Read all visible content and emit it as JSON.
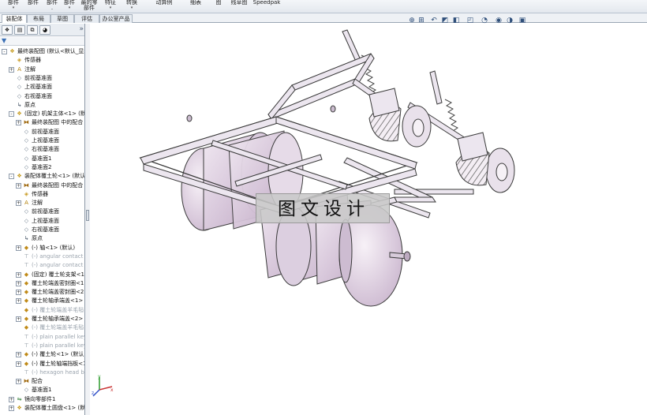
{
  "ribbon": {
    "items": [
      {
        "label": "部件",
        "arrow": true
      },
      {
        "label": "部件",
        "arrow": false
      },
      {
        "label": "部件\n.",
        "arrow": false
      },
      {
        "label": "部件",
        "arrow": true
      },
      {
        "label": "最的零\n部件",
        "arrow": false
      },
      {
        "label": "特征",
        "arrow": true
      },
      {
        "label": "转换",
        "arrow": true
      },
      {
        "label": "动算例",
        "arrow": false
      },
      {
        "label": "细表",
        "arrow": false
      },
      {
        "label": "图",
        "arrow": false
      },
      {
        "label": "线草图",
        "arrow": false
      },
      {
        "label": "Speedpak",
        "arrow": false
      }
    ]
  },
  "command_tabs": [
    {
      "label": "装配体",
      "active": true
    },
    {
      "label": "布局",
      "active": false
    },
    {
      "label": "草图",
      "active": false
    },
    {
      "label": "评估",
      "active": false
    },
    {
      "label": "办公室产品",
      "active": false
    }
  ],
  "panel": {
    "collapse_glyph": "»",
    "filter_glyph": "▼",
    "tree": [
      {
        "label": "最终装配图 (默认<默认_显示",
        "indent": 0,
        "toggle": "-",
        "icon": "assembly-icon",
        "dim": false
      },
      {
        "label": "传感器",
        "indent": 1,
        "toggle": "",
        "icon": "sensor-icon",
        "dim": false
      },
      {
        "label": "注解",
        "indent": 1,
        "toggle": "+",
        "icon": "annotation-icon",
        "dim": false
      },
      {
        "label": "前视基准面",
        "indent": 1,
        "toggle": "",
        "icon": "plane-icon",
        "dim": false
      },
      {
        "label": "上视基准面",
        "indent": 1,
        "toggle": "",
        "icon": "plane-icon",
        "dim": false
      },
      {
        "label": "右视基准面",
        "indent": 1,
        "toggle": "",
        "icon": "plane-icon",
        "dim": false
      },
      {
        "label": "原点",
        "indent": 1,
        "toggle": "",
        "icon": "origin-icon",
        "dim": false
      },
      {
        "label": "(固定) 机架主体<1> (默认",
        "indent": 1,
        "toggle": "-",
        "icon": "assembly-icon",
        "dim": false
      },
      {
        "label": "最终装配图 中的配合",
        "indent": 2,
        "toggle": "+",
        "icon": "mates-icon",
        "dim": false
      },
      {
        "label": "前视基准面",
        "indent": 2,
        "toggle": "",
        "icon": "plane-icon",
        "dim": false
      },
      {
        "label": "上视基准面",
        "indent": 2,
        "toggle": "",
        "icon": "plane-icon",
        "dim": false
      },
      {
        "label": "右视基准面",
        "indent": 2,
        "toggle": "",
        "icon": "plane-icon",
        "dim": false
      },
      {
        "label": "基准面1",
        "indent": 2,
        "toggle": "",
        "icon": "plane-icon",
        "dim": false
      },
      {
        "label": "基准面2",
        "indent": 2,
        "toggle": "",
        "icon": "plane-icon",
        "dim": false
      },
      {
        "label": "装配体覆土轮<1> (默认<",
        "indent": 1,
        "toggle": "-",
        "icon": "assembly-icon",
        "dim": false
      },
      {
        "label": "最终装配图 中的配合",
        "indent": 2,
        "toggle": "+",
        "icon": "mates-icon",
        "dim": false
      },
      {
        "label": "传感器",
        "indent": 2,
        "toggle": "",
        "icon": "sensor-icon",
        "dim": false
      },
      {
        "label": "注解",
        "indent": 2,
        "toggle": "+",
        "icon": "annotation-icon",
        "dim": false
      },
      {
        "label": "前视基准面",
        "indent": 2,
        "toggle": "",
        "icon": "plane-icon",
        "dim": false
      },
      {
        "label": "上视基准面",
        "indent": 2,
        "toggle": "",
        "icon": "plane-icon",
        "dim": false
      },
      {
        "label": "右视基准面",
        "indent": 2,
        "toggle": "",
        "icon": "plane-icon",
        "dim": false
      },
      {
        "label": "原点",
        "indent": 2,
        "toggle": "",
        "icon": "origin-icon",
        "dim": false
      },
      {
        "label": "(-) 轴<1> (默认)",
        "indent": 2,
        "toggle": "+",
        "icon": "part-icon",
        "dim": false
      },
      {
        "label": "(-) angular contact b",
        "indent": 2,
        "toggle": "",
        "icon": "toolbox-icon",
        "dim": true
      },
      {
        "label": "(-) angular contact b",
        "indent": 2,
        "toggle": "",
        "icon": "toolbox-icon",
        "dim": true
      },
      {
        "label": "(固定) 覆土轮支架<1>",
        "indent": 2,
        "toggle": "+",
        "icon": "part-icon",
        "dim": false
      },
      {
        "label": "覆土轮端盖密封圈<1>",
        "indent": 2,
        "toggle": "+",
        "icon": "part-icon",
        "dim": false
      },
      {
        "label": "覆土轮端盖密封圈<2>",
        "indent": 2,
        "toggle": "+",
        "icon": "part-icon",
        "dim": false
      },
      {
        "label": "覆土轮轴承端盖<1> (",
        "indent": 2,
        "toggle": "+",
        "icon": "part-icon",
        "dim": false
      },
      {
        "label": "(-) 覆土轮端盖羊毛毡",
        "indent": 2,
        "toggle": "",
        "icon": "part-icon",
        "dim": true
      },
      {
        "label": "覆土轮轴承端盖<2> (",
        "indent": 2,
        "toggle": "+",
        "icon": "part-icon",
        "dim": false
      },
      {
        "label": "(-) 覆土轮端盖羊毛毡",
        "indent": 2,
        "toggle": "",
        "icon": "part-icon",
        "dim": true
      },
      {
        "label": "(-) plain parallel key",
        "indent": 2,
        "toggle": "",
        "icon": "toolbox-icon",
        "dim": true
      },
      {
        "label": "(-) plain parallel key",
        "indent": 2,
        "toggle": "",
        "icon": "toolbox-icon",
        "dim": true
      },
      {
        "label": "(-) 覆土轮<1> (默认<",
        "indent": 2,
        "toggle": "+",
        "icon": "part-icon",
        "dim": false
      },
      {
        "label": "(-) 覆土轮轴端挡板<1",
        "indent": 2,
        "toggle": "+",
        "icon": "part-icon",
        "dim": false
      },
      {
        "label": "(-) hexagon head bo",
        "indent": 2,
        "toggle": "",
        "icon": "toolbox-icon",
        "dim": true
      },
      {
        "label": "配合",
        "indent": 2,
        "toggle": "+",
        "icon": "mates-icon",
        "dim": false
      },
      {
        "label": "基准面1",
        "indent": 2,
        "toggle": "",
        "icon": "plane-icon",
        "dim": false
      },
      {
        "label": "镜向零部件1",
        "indent": 1,
        "toggle": "+",
        "icon": "mirror-icon",
        "dim": false
      },
      {
        "label": "装配体覆土圆盘<1> (默认",
        "indent": 1,
        "toggle": "+",
        "icon": "assembly-icon",
        "dim": false
      }
    ]
  },
  "hud": {
    "icons": [
      "zoom-fit-icon",
      "zoom-area-icon",
      "previous-view-icon",
      "section-view-icon",
      "view-orientation-icon",
      "display-style-icon",
      "hide-show-icon",
      "edit-appearance-icon",
      "apply-scene-icon",
      "view-settings-icon"
    ]
  },
  "watermark": {
    "text": "图文设计"
  },
  "triad": {
    "x": "x",
    "y": "y",
    "z": "z"
  },
  "colors": {
    "frame_fill": "#ece6ef",
    "frame_stroke": "#3a3a3a",
    "drum_fill": "#e4d7e6",
    "accent": "#3a6fb5"
  }
}
